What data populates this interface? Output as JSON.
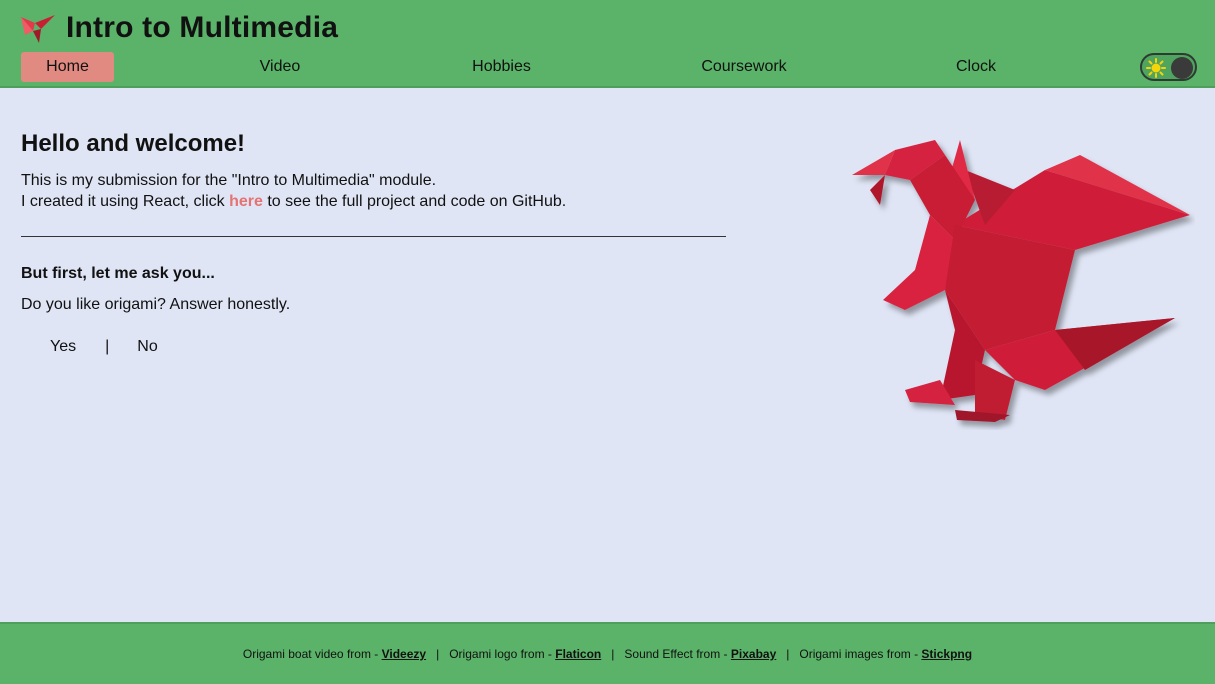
{
  "header": {
    "title": "Intro to Multimedia",
    "logo_icon": "origami-bird-icon",
    "nav": [
      {
        "label": "Home",
        "active": true
      },
      {
        "label": "Video",
        "active": false
      },
      {
        "label": "Hobbies",
        "active": false
      },
      {
        "label": "Coursework",
        "active": false
      },
      {
        "label": "Clock",
        "active": false
      }
    ],
    "theme_toggle": {
      "icon": "sun-icon",
      "state": "light"
    }
  },
  "main": {
    "heading": "Hello and welcome!",
    "intro_line1": "This is my submission for the \"Intro to Multimedia\" module.",
    "intro_line2_pre": "I created it using React, click ",
    "intro_link": "here",
    "intro_line2_post": " to see the full project and code on GitHub.",
    "subheading": "But first, let me ask you...",
    "question": "Do you like origami? Answer honestly.",
    "answer_yes": "Yes",
    "answer_separator": "|",
    "answer_no": "No",
    "image": "origami-dragon-image"
  },
  "footer": {
    "credits": [
      {
        "text": "Origami boat video from - ",
        "link": "Videezy"
      },
      {
        "text": "Origami logo from - ",
        "link": "Flaticon"
      },
      {
        "text": "Sound Effect from - ",
        "link": "Pixabay"
      },
      {
        "text": "Origami images from - ",
        "link": "Stickpng"
      }
    ],
    "separator": "|"
  },
  "colors": {
    "header_bg": "#5ab369",
    "page_bg": "#dfe5f5",
    "active_nav": "#e08a82",
    "link": "#e57373",
    "dragon_red": "#d41f3a"
  }
}
